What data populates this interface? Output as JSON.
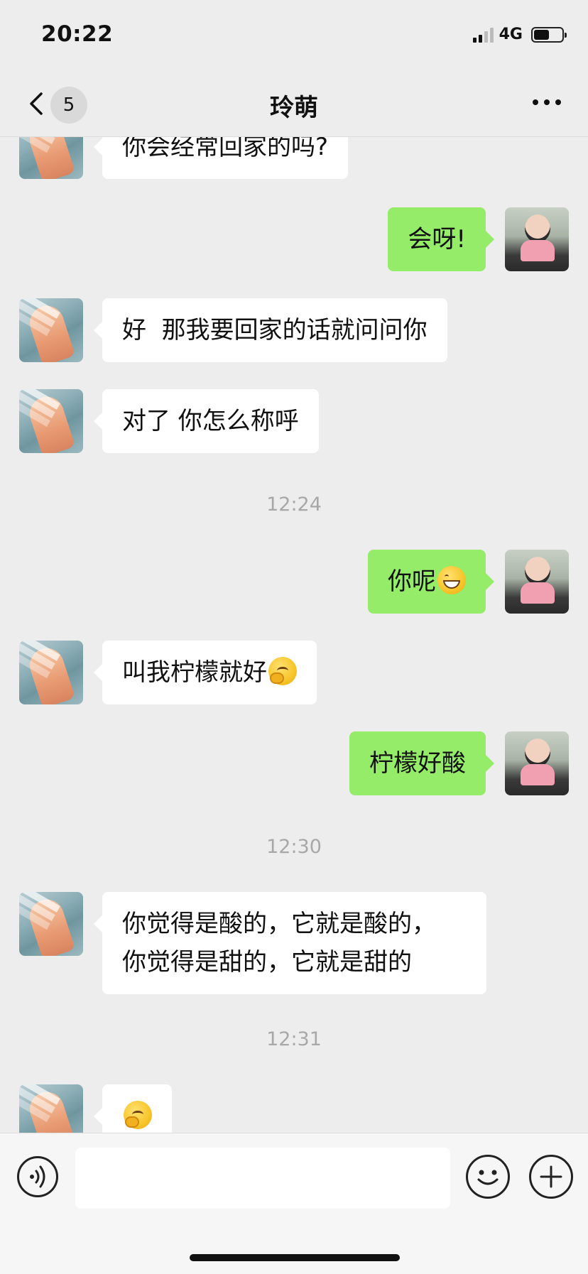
{
  "status_bar": {
    "time": "20:22",
    "network": "4G",
    "battery_level": 0.55
  },
  "nav": {
    "back_icon": "chevron-left-icon",
    "unread_count": "5",
    "title": "玲萌",
    "more_icon": "more-dots-icon"
  },
  "messages": [
    {
      "side": "in",
      "lines": [
        "你会经常回家的吗?"
      ]
    },
    {
      "side": "out",
      "lines": [
        "会呀!"
      ]
    },
    {
      "side": "in",
      "lines": [
        "好  那我要回家的话就问问你"
      ]
    },
    {
      "side": "in",
      "lines": [
        "对了 你怎么称呼"
      ]
    },
    {
      "type": "time",
      "text": "12:24"
    },
    {
      "side": "out",
      "lines": [
        "你呢"
      ],
      "emoji": "grinning-face-emoji"
    },
    {
      "side": "in",
      "lines": [
        "叫我柠檬就好"
      ],
      "emoji": "thinking-face-emoji"
    },
    {
      "side": "out",
      "lines": [
        "柠檬好酸"
      ]
    },
    {
      "type": "time",
      "text": "12:30"
    },
    {
      "side": "in",
      "lines": [
        "你觉得是酸的，它就是酸的，",
        "你觉得是甜的，它就是甜的"
      ]
    },
    {
      "type": "time",
      "text": "12:31"
    },
    {
      "side": "in",
      "lines": [],
      "emoji": "thinking-face-emoji"
    }
  ],
  "input_bar": {
    "voice_icon": "voice-icon",
    "text_value": "",
    "emoji_icon": "emoji-icon",
    "plus_icon": "plus-icon"
  },
  "colors": {
    "background": "#ededed",
    "incoming_bubble": "#ffffff",
    "outgoing_bubble": "#95ec69",
    "timestamp_text": "#a8a8a8"
  }
}
